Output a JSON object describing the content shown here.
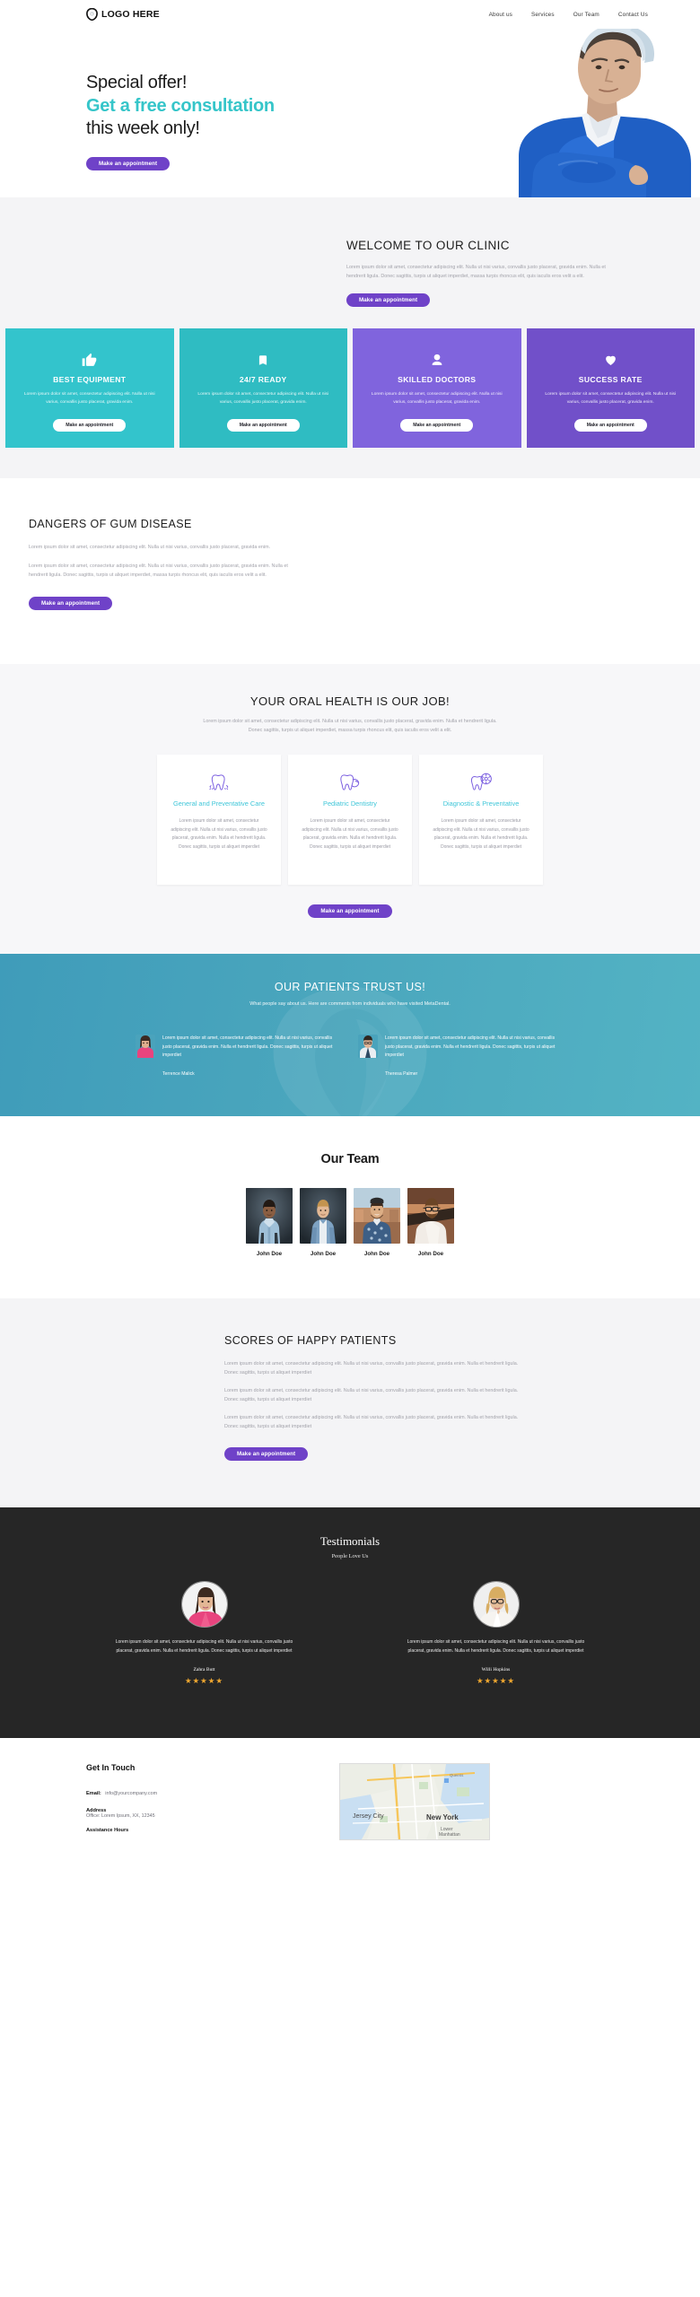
{
  "brand": {
    "logo_text": "LOGO HERE",
    "logo_icon": "shield-tooth-icon",
    "accent_teal": "#35c5c9",
    "accent_purple": "#6f42c8",
    "dark": "#262626"
  },
  "nav": {
    "items": [
      {
        "label": "About us"
      },
      {
        "label": "Services"
      },
      {
        "label": "Our Team"
      },
      {
        "label": "Contact Us"
      }
    ]
  },
  "hero": {
    "line1": "Special offer!",
    "line2": "Get a free consultation",
    "line3": "this week only!",
    "cta": "Make an appointment",
    "image_alt": "male-dentist-portrait"
  },
  "welcome": {
    "title": "WELCOME TO OUR CLINIC",
    "body": "Lorem ipsum dolor sit amet, consectetur adipiscing elit. Nulla ut nisi varius, convallis justo placerat, gravida enim. Nulla et hendrerit ligula. Donec sagittis, turpis ut aliquet imperdiet, massa turpis rhoncus elit, quis iaculis eros velit a elit.",
    "cta": "Make an appointment"
  },
  "features": {
    "cta": "Make an appointment",
    "cards": [
      {
        "icon": "thumbs-up-icon",
        "title": "BEST EQUIPMENT",
        "body": "Lorem ipsum dolor sit amet, consectetur adipiscing elit. Nulla ut nisi varius, convallis justo placerat, gravida enim.",
        "color": "#33c4cc"
      },
      {
        "icon": "bookmark-icon",
        "title": "24/7 READY",
        "body": "Lorem ipsum dolor sit amet, consectetur adipiscing elit. Nulla ut nisi varius, convallis justo placerat, gravida enim.",
        "color": "#2fbcc2"
      },
      {
        "icon": "user-icon",
        "title": "SKILLED DOCTORS",
        "body": "Lorem ipsum dolor sit amet, consectetur adipiscing elit. Nulla ut nisi varius, convallis justo placerat, gravida enim.",
        "color": "#8064dd"
      },
      {
        "icon": "heart-icon",
        "title": "SUCCESS RATE",
        "body": "Lorem ipsum dolor sit amet, consectetur adipiscing elit. Nulla ut nisi varius, convallis justo placerat, gravida enim.",
        "color": "#7150c9"
      }
    ]
  },
  "dangers": {
    "title": "DANGERS OF GUM DISEASE",
    "p1": "Lorem ipsum dolor sit amet, consectetur adipiscing elit. Nulla ut nisi varius, convallis justo placerat, gravida enim.",
    "p2": "Lorem ipsum dolor sit amet, consectetur adipiscing elit. Nulla ut nisi varius, convallis justo placerat, gravida enim. Nulla et hendrerit ligula. Donec sagittis, turpis ut aliquet imperdiet, massa turpis rhoncus elit, quis iaculis eros velit a elit.",
    "cta": "Make an appointment"
  },
  "oral": {
    "title": "YOUR ORAL HEALTH IS OUR JOB!",
    "lead": "Lorem ipsum dolor sit amet, consectetur adipiscing elit. Nulla ut nisi varius, convallis justo placerat, gravida enim. Nulla et hendrerit ligula. Donec sagittis, turpis ut aliquet imperdiet, massa turpis rhoncus elit, quis iaculis eros velit a elit.",
    "cta": "Make an appointment",
    "services": [
      {
        "icon": "tooth-sparkle-icon",
        "title": "General and Preventative Care",
        "body": "Lorem ipsum dolor sit amet, consectetur adipiscing elit. Nulla ut nisi varius, convallis justo placerat, gravida enim. Nulla et hendrerit ligula. Donec sagittis, turpis ut aliquet imperdiet"
      },
      {
        "icon": "tooth-child-icon",
        "title": "Pediatric Dentistry",
        "body": "Lorem ipsum dolor sit amet, consectetur adipiscing elit. Nulla ut nisi varius, convallis justo placerat, gravida enim. Nulla et hendrerit ligula. Donec sagittis, turpis ut aliquet imperdiet"
      },
      {
        "icon": "tooth-xray-icon",
        "title": "Diagnostic & Preventative",
        "body": "Lorem ipsum dolor sit amet, consectetur adipiscing elit. Nulla ut nisi varius, convallis justo placerat, gravida enim. Nulla et hendrerit ligula. Donec sagittis, turpis ut aliquet imperdiet"
      }
    ]
  },
  "trust": {
    "title": "OUR PATIENTS TRUST US!",
    "subtitle": "What people say about us. Here are comments from individuals who have visited MetaDental.",
    "testimonials": [
      {
        "quote": "Lorem ipsum dolor sit amet, consectetur adipiscing elit. Nulla ut nisi varius, convallis justo placerat, gravida enim. Nulla et hendrerit ligula. Donec sagittis, turpis ut aliquet imperdiet",
        "name": "Terrence Malick",
        "avatar": "woman-pink-top-avatar"
      },
      {
        "quote": "Lorem ipsum dolor sit amet, consectetur adipiscing elit. Nulla ut nisi varius, convallis justo placerat, gravida enim. Nulla et hendrerit ligula. Donec sagittis, turpis ut aliquet imperdiet",
        "name": "Theresa Palmer",
        "avatar": "man-glasses-avatar"
      }
    ]
  },
  "team": {
    "title": "Our Team",
    "members": [
      {
        "name": "John Doe",
        "photo": "man-blue-shirt"
      },
      {
        "name": "John Doe",
        "photo": "man-denim-jacket"
      },
      {
        "name": "John Doe",
        "photo": "man-patterned-shirt"
      },
      {
        "name": "John Doe",
        "photo": "man-glasses-white-tee"
      }
    ]
  },
  "scores": {
    "title": "SCORES OF HAPPY PATIENTS",
    "p1": "Lorem ipsum dolor sit amet, consectetur adipiscing elit. Nulla ut nisi varius, convallis justo placerat, gravida enim. Nulla et hendrerit ligula. Donec sagittis, turpis ut aliquet imperdiet",
    "p2": "Lorem ipsum dolor sit amet, consectetur adipiscing elit. Nulla ut nisi varius, convallis justo placerat, gravida enim. Nulla et hendrerit ligula. Donec sagittis, turpis ut aliquet imperdiet",
    "p3": "Lorem ipsum dolor sit amet, consectetur adipiscing elit. Nulla ut nisi varius, convallis justo placerat, gravida enim. Nulla et hendrerit ligula. Donec sagittis, turpis ut aliquet imperdiet",
    "cta": "Make an appointment"
  },
  "testimonials": {
    "title": "Testimonials",
    "subtitle": "People Love Us",
    "items": [
      {
        "quote": "Lorem ipsum dolor sit amet, consectetur adipiscing elit. Nulla ut nisi varius, convallis justo placerat, gravida enim. Nulla et hendrerit ligula. Donec sagittis, turpis ut aliquet imperdiet",
        "name": "Zahra Butt",
        "stars": "★★★★★",
        "avatar": "woman-dark-hair-pink-dress"
      },
      {
        "quote": "Lorem ipsum dolor sit amet, consectetur adipiscing elit. Nulla ut nisi varius, convallis justo placerat, gravida enim. Nulla et hendrerit ligula. Donec sagittis, turpis ut aliquet imperdiet",
        "name": "Willi Hopkins",
        "stars": "★★★★★",
        "avatar": "woman-blonde-glasses"
      }
    ],
    "star_color": "#f0a830"
  },
  "footer": {
    "title": "Get In Touch",
    "email_label": "Email:",
    "email_value": "info@yourcompany.com",
    "address_label": "Address",
    "address_value": "Office: Lorem Ipsum, XX, 12345",
    "hours_label": "Assistance Hours",
    "map_labels": {
      "city_main": "New York",
      "city_left": "Jersey City",
      "district": "Lower Manhattan"
    }
  }
}
